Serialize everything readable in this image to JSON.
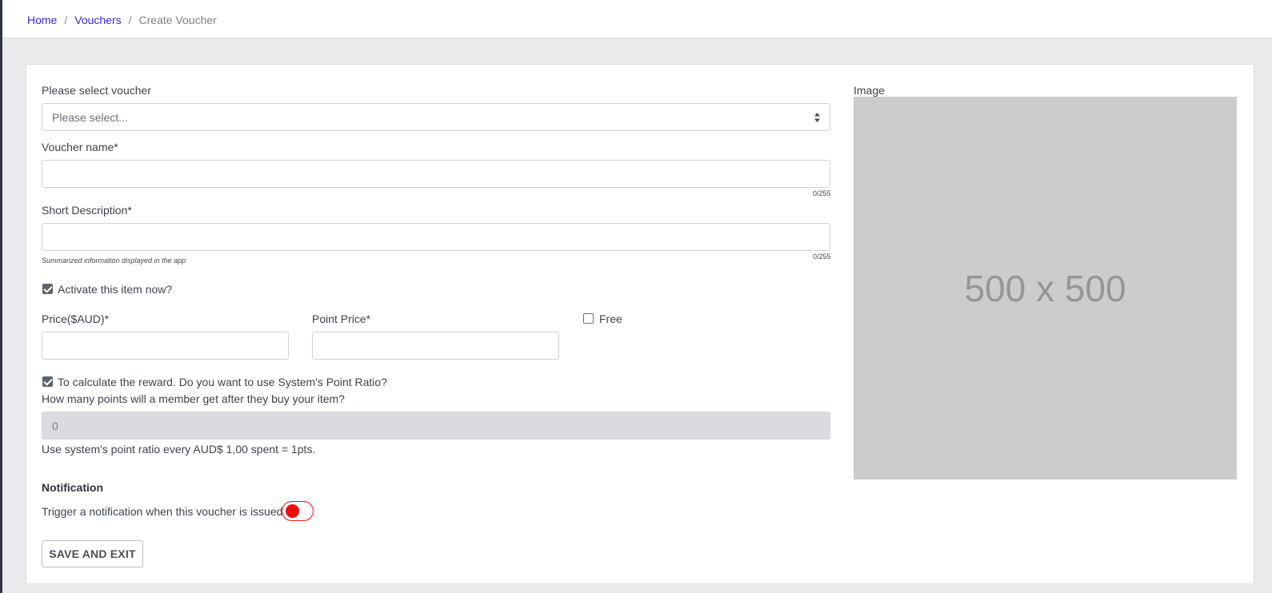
{
  "breadcrumb": {
    "home": "Home",
    "vouchers": "Vouchers",
    "current": "Create Voucher",
    "separator": "/"
  },
  "form": {
    "voucher_select": {
      "label": "Please select voucher",
      "selected": "Please select..."
    },
    "voucher_name": {
      "label": "Voucher name*",
      "value": "",
      "counter": "0/255"
    },
    "short_description": {
      "label": "Short Description*",
      "value": "",
      "counter": "0/255",
      "hint": "Summarized information displayed in the app"
    },
    "activate": {
      "label": "Activate this item now?",
      "checked": true
    },
    "price": {
      "label": "Price($AUD)*",
      "value": ""
    },
    "point_price": {
      "label": "Point Price*",
      "value": ""
    },
    "free": {
      "label": "Free",
      "checked": false
    },
    "point_ratio": {
      "label": "To calculate the reward. Do you want to use System's Point Ratio?",
      "checked": true,
      "question": "How many points will a member get after they buy your item?",
      "value": "0",
      "note": "Use system's point ratio every AUD$ 1,00 spent = 1pts."
    },
    "notification": {
      "title": "Notification",
      "label": "Trigger a notification when this voucher is issued",
      "enabled": false
    },
    "save_label": "SAVE AND EXIT"
  },
  "image": {
    "label": "Image",
    "placeholder": "500 x 500"
  },
  "colors": {
    "link": "#3b2bd9",
    "toggle_off": "#f20d0d",
    "image_placeholder": "#cccccc"
  }
}
